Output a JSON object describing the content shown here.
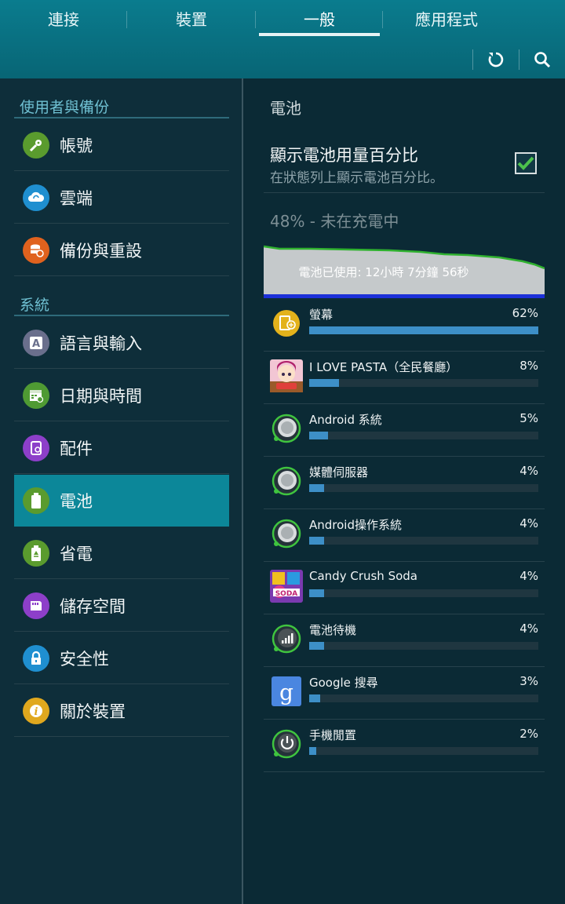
{
  "header": {
    "tabs": [
      {
        "label": "連接",
        "active": false
      },
      {
        "label": "裝置",
        "active": false
      },
      {
        "label": "一般",
        "active": true
      },
      {
        "label": "應用程式",
        "active": false
      }
    ],
    "actions": [
      {
        "icon": "refresh-icon"
      },
      {
        "icon": "search-icon"
      }
    ]
  },
  "sidebar": {
    "sections": [
      {
        "title": "使用者與備份",
        "items": [
          {
            "label": "帳號",
            "icon": "key-icon",
            "color": "#5a9b2e",
            "active": false
          },
          {
            "label": "雲端",
            "icon": "cloud-sync-icon",
            "color": "#1f8fd0",
            "active": false
          },
          {
            "label": "備份與重設",
            "icon": "backup-icon",
            "color": "#e0621e",
            "active": false
          }
        ]
      },
      {
        "title": "系統",
        "items": [
          {
            "label": "語言與輸入",
            "icon": "language-icon",
            "color": "#6a6f8c",
            "active": false
          },
          {
            "label": "日期與時間",
            "icon": "calendar-icon",
            "color": "#4f9a33",
            "active": false
          },
          {
            "label": "配件",
            "icon": "accessory-icon",
            "color": "#8d3fc9",
            "active": false
          },
          {
            "label": "電池",
            "icon": "battery-icon",
            "color": "#5a9b2e",
            "active": true
          },
          {
            "label": "省電",
            "icon": "power-saving-icon",
            "color": "#5a9b2e",
            "active": false
          },
          {
            "label": "儲存空間",
            "icon": "storage-icon",
            "color": "#8d3fc9",
            "active": false
          },
          {
            "label": "安全性",
            "icon": "lock-icon",
            "color": "#1f8fd0",
            "active": false
          },
          {
            "label": "關於裝置",
            "icon": "info-icon",
            "color": "#e0a81e",
            "active": false
          }
        ]
      }
    ]
  },
  "battery": {
    "title": "電池",
    "show_percent": {
      "title": "顯示電池用量百分比",
      "subtitle": "在狀態列上顯示電池百分比。",
      "checked": true
    },
    "status": "48% - 未在充電中",
    "graph_label": "電池已使用: 12小時 7分鐘 56秒",
    "usage": [
      {
        "name": "螢幕",
        "percent": 62,
        "label": "62%",
        "icon": "screen-icon"
      },
      {
        "name": "I LOVE PASTA（全民餐廳）",
        "percent": 8,
        "label": "8%",
        "icon": "pasta-game-icon"
      },
      {
        "name": "Android 系統",
        "percent": 5,
        "label": "5%",
        "icon": "android-system-icon"
      },
      {
        "name": "媒體伺服器",
        "percent": 4,
        "label": "4%",
        "icon": "media-server-icon"
      },
      {
        "name": "Android操作系統",
        "percent": 4,
        "label": "4%",
        "icon": "android-os-icon"
      },
      {
        "name": "Candy Crush Soda",
        "percent": 4,
        "label": "4%",
        "icon": "candy-crush-icon"
      },
      {
        "name": "電池待機",
        "percent": 4,
        "label": "4%",
        "icon": "cell-standby-icon"
      },
      {
        "name": "Google 搜尋",
        "percent": 3,
        "label": "3%",
        "icon": "google-search-icon"
      },
      {
        "name": "手機閒置",
        "percent": 2,
        "label": "2%",
        "icon": "phone-idle-icon"
      }
    ]
  }
}
